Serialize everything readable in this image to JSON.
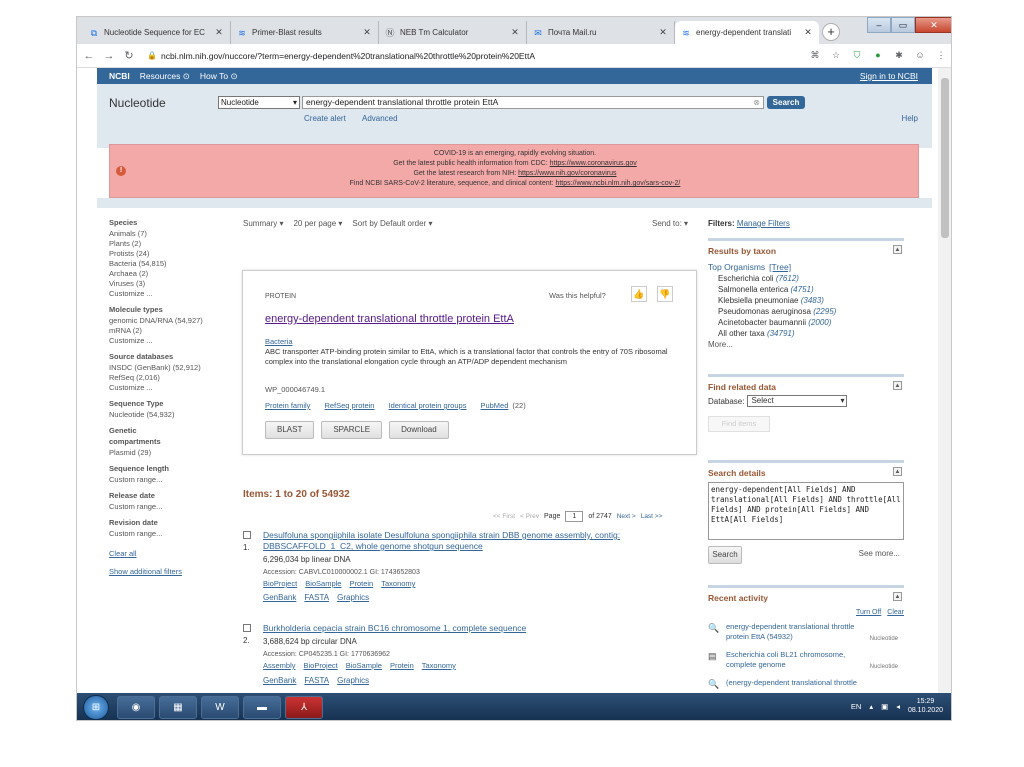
{
  "browser": {
    "tabs": [
      {
        "title": "Nucleotide Sequence for EC",
        "icon": "dna-icon"
      },
      {
        "title": "Primer-Blast results",
        "icon": "ncbi-icon"
      },
      {
        "title": "NEB Tm Calculator",
        "icon": "neb-icon"
      },
      {
        "title": "Почта Mail.ru",
        "icon": "mail-icon"
      },
      {
        "title": "energy-dependent translati",
        "icon": "ncbi-icon"
      }
    ],
    "close_glyph": "✕",
    "new_tab_glyph": "+",
    "url": "ncbi.nlm.nih.gov/nuccore/?term=energy-dependent%20translational%20throttle%20protein%20EttA"
  },
  "ncbi": {
    "logo": "NCBI",
    "resources": "Resources",
    "howto": "How To",
    "signin": "Sign in to NCBI",
    "db_title": "Nucleotide",
    "db_select": "Nucleotide",
    "search_value": "energy-dependent translational throttle protein EttA",
    "search_button": "Search",
    "create_alert": "Create alert",
    "advanced": "Advanced",
    "help": "Help"
  },
  "covid": {
    "line1": "COVID-19 is an emerging, rapidly evolving situation.",
    "line2_text": "Get the latest public health information from CDC: ",
    "line2_link": "https://www.coronavirus.gov",
    "line3_text": "Get the latest research from NIH: ",
    "line3_link": "https://www.nih.gov/coronavirus",
    "line4_text": "Find NCBI SARS-CoV-2 literature, sequence, and clinical content: ",
    "line4_link": "https://www.ncbi.nlm.nih.gov/sars-cov-2/"
  },
  "facets": {
    "species_title": "Species",
    "species": [
      "Animals (7)",
      "Plants (2)",
      "Protists (24)",
      "Bacteria (54,815)",
      "Archaea (2)",
      "Viruses (3)",
      "Customize ..."
    ],
    "moltype_title": "Molecule types",
    "moltype": [
      "genomic DNA/RNA (54,927)",
      "mRNA (2)",
      "Customize ..."
    ],
    "source_title": "Source databases",
    "source": [
      "INSDC (GenBank) (52,912)",
      "RefSeq (2,016)",
      "Customize ..."
    ],
    "seqtype_title": "Sequence Type",
    "seqtype": [
      "Nucleotide (54,932)"
    ],
    "genetic_title1": "Genetic",
    "genetic_title2": "compartments",
    "genetic": [
      "Plasmid (29)"
    ],
    "length_title": "Sequence length",
    "length": [
      "Custom range..."
    ],
    "release_title": "Release date",
    "release": [
      "Custom range..."
    ],
    "revision_title": "Revision date",
    "revision": [
      "Custom range..."
    ],
    "clear_all": "Clear all",
    "show_filters": "Show additional filters"
  },
  "summary": {
    "format": "Summary ▾",
    "per_page": "20 per page ▾",
    "sort": "Sort by Default order ▾",
    "send_to": "Send to: ▾"
  },
  "card": {
    "kind": "PROTEIN",
    "helpful": "Was this helpful?",
    "title": "energy-dependent translational throttle protein EttA",
    "organism": "Bacteria",
    "description": "ABC transporter ATP-binding protein similar to EttA, which is a translational factor that controls the entry of 70S ribosomal complex into the translational elongation cycle through an ATP/ADP dependent mechanism",
    "accession": "WP_000046749.1",
    "links": [
      "Protein family",
      "RefSeq protein",
      "Identical protein groups",
      "PubMed"
    ],
    "pubmed_count": "(22)",
    "buttons": [
      "BLAST",
      "SPARCLE",
      "Download"
    ]
  },
  "results": {
    "items_label": "Items: 1 to 20 of 54932",
    "pager_first": "<< First",
    "pager_prev": "< Prev",
    "pager_page": "Page",
    "pager_value": "1",
    "pager_of": "of 2747",
    "pager_next": "Next >",
    "pager_last": "Last >>",
    "list": [
      {
        "num": "1.",
        "title": "Desulfoluna spongiiphila isolate Desulfoluna spongiiphila strain DBB genome assembly, contig: DBBSCAFFOLD_1_C2, whole genome shotgun sequence",
        "desc": "6,296,034 bp linear DNA",
        "acc": "Accession: CABVLC010000002.1   GI: 1743652803",
        "links": [
          "BioProject",
          "BioSample",
          "Protein",
          "Taxonomy"
        ],
        "links2": [
          "GenBank",
          "FASTA",
          "Graphics"
        ]
      },
      {
        "num": "2.",
        "title": "Burkholderia cepacia strain BC16 chromosome 1, complete sequence",
        "desc": "3,688,624 bp circular DNA",
        "acc": "Accession: CP045235.1   GI: 1770636962",
        "links": [
          "Assembly",
          "BioProject",
          "BioSample",
          "Protein",
          "Taxonomy"
        ],
        "links2": [
          "GenBank",
          "FASTA",
          "Graphics"
        ]
      }
    ]
  },
  "right": {
    "filters_label": "Filters:",
    "manage_filters": "Manage Filters",
    "taxon_title": "Results by taxon",
    "top_organisms": "Top Organisms",
    "tree": "[Tree]",
    "taxa": [
      {
        "name": "Escherichia coli",
        "count": "(7612)"
      },
      {
        "name": "Salmonella enterica",
        "count": "(4751)"
      },
      {
        "name": "Klebsiella pneumoniae",
        "count": "(3483)"
      },
      {
        "name": "Pseudomonas aeruginosa",
        "count": "(2295)"
      },
      {
        "name": "Acinetobacter baumannii",
        "count": "(2000)"
      },
      {
        "name": "All other taxa",
        "count": "(34791)"
      }
    ],
    "more": "More...",
    "related_title": "Find related data",
    "database_label": "Database:",
    "database_value": "Select",
    "find_items": "Find items",
    "details_title": "Search details",
    "query": "energy-dependent[All Fields] AND translational[All Fields] AND throttle[All Fields] AND protein[All Fields] AND EttA[All Fields]",
    "search_btn": "Search",
    "see_more": "See more...",
    "activity_title": "Recent activity",
    "turn_off": "Turn Off",
    "clear": "Clear",
    "activity": [
      {
        "text": "energy-dependent translational throttle protein EttA (54932)",
        "db": "Nucleotide",
        "icon": "search-icon"
      },
      {
        "text": "Escherichia coli BL21 chromosome, complete genome",
        "db": "Nucleotide",
        "icon": "document-icon"
      },
      {
        "text": "(energy-dependent translational throttle",
        "db": "",
        "icon": "search-icon"
      }
    ]
  },
  "taskbar": {
    "lang": "EN",
    "time": "15:29",
    "date": "08.10.2020"
  }
}
